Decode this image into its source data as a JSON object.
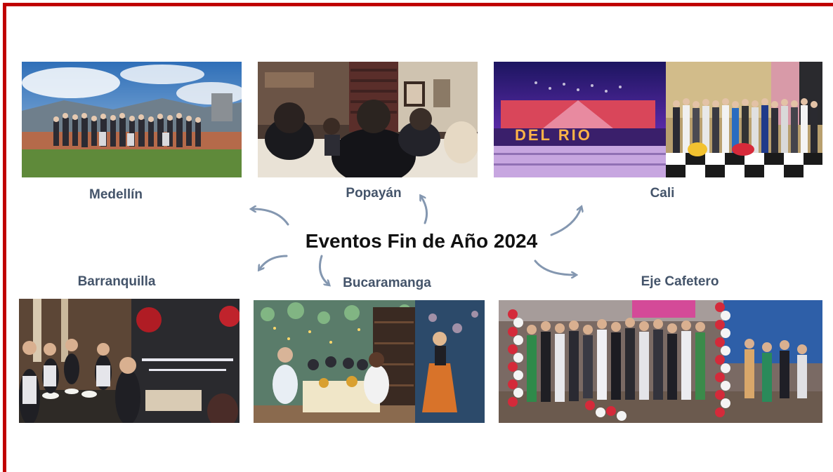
{
  "title": "Eventos Fin de Año 2024",
  "colors": {
    "frame": "#c00000",
    "city_text": "#44546a",
    "title_text": "#111111",
    "arrow": "#8497b0"
  },
  "cities": {
    "medellin": "Medellín",
    "popayan": "Popayán",
    "cali": "Cali",
    "barranquilla": "Barranquilla",
    "bucaramanga": "Bucaramanga",
    "eje_cafetero": "Eje Cafetero"
  },
  "sign_text": "DEL RIO"
}
